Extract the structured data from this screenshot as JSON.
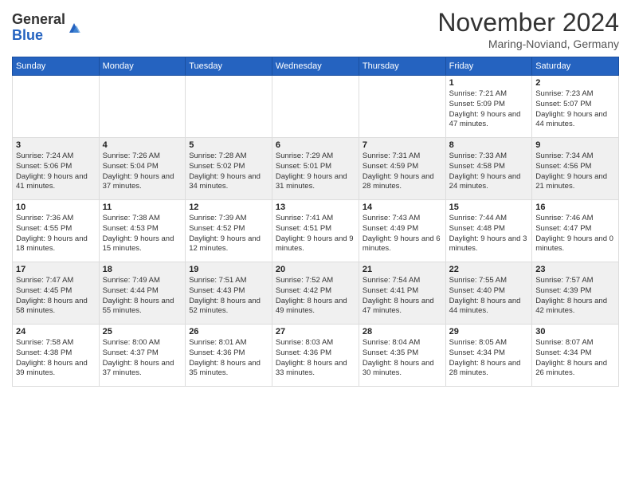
{
  "logo": {
    "line1": "General",
    "line2": "Blue"
  },
  "title": "November 2024",
  "location": "Maring-Noviand, Germany",
  "weekdays": [
    "Sunday",
    "Monday",
    "Tuesday",
    "Wednesday",
    "Thursday",
    "Friday",
    "Saturday"
  ],
  "weeks": [
    [
      {
        "day": "",
        "info": ""
      },
      {
        "day": "",
        "info": ""
      },
      {
        "day": "",
        "info": ""
      },
      {
        "day": "",
        "info": ""
      },
      {
        "day": "",
        "info": ""
      },
      {
        "day": "1",
        "info": "Sunrise: 7:21 AM\nSunset: 5:09 PM\nDaylight: 9 hours and 47 minutes."
      },
      {
        "day": "2",
        "info": "Sunrise: 7:23 AM\nSunset: 5:07 PM\nDaylight: 9 hours and 44 minutes."
      }
    ],
    [
      {
        "day": "3",
        "info": "Sunrise: 7:24 AM\nSunset: 5:06 PM\nDaylight: 9 hours and 41 minutes."
      },
      {
        "day": "4",
        "info": "Sunrise: 7:26 AM\nSunset: 5:04 PM\nDaylight: 9 hours and 37 minutes."
      },
      {
        "day": "5",
        "info": "Sunrise: 7:28 AM\nSunset: 5:02 PM\nDaylight: 9 hours and 34 minutes."
      },
      {
        "day": "6",
        "info": "Sunrise: 7:29 AM\nSunset: 5:01 PM\nDaylight: 9 hours and 31 minutes."
      },
      {
        "day": "7",
        "info": "Sunrise: 7:31 AM\nSunset: 4:59 PM\nDaylight: 9 hours and 28 minutes."
      },
      {
        "day": "8",
        "info": "Sunrise: 7:33 AM\nSunset: 4:58 PM\nDaylight: 9 hours and 24 minutes."
      },
      {
        "day": "9",
        "info": "Sunrise: 7:34 AM\nSunset: 4:56 PM\nDaylight: 9 hours and 21 minutes."
      }
    ],
    [
      {
        "day": "10",
        "info": "Sunrise: 7:36 AM\nSunset: 4:55 PM\nDaylight: 9 hours and 18 minutes."
      },
      {
        "day": "11",
        "info": "Sunrise: 7:38 AM\nSunset: 4:53 PM\nDaylight: 9 hours and 15 minutes."
      },
      {
        "day": "12",
        "info": "Sunrise: 7:39 AM\nSunset: 4:52 PM\nDaylight: 9 hours and 12 minutes."
      },
      {
        "day": "13",
        "info": "Sunrise: 7:41 AM\nSunset: 4:51 PM\nDaylight: 9 hours and 9 minutes."
      },
      {
        "day": "14",
        "info": "Sunrise: 7:43 AM\nSunset: 4:49 PM\nDaylight: 9 hours and 6 minutes."
      },
      {
        "day": "15",
        "info": "Sunrise: 7:44 AM\nSunset: 4:48 PM\nDaylight: 9 hours and 3 minutes."
      },
      {
        "day": "16",
        "info": "Sunrise: 7:46 AM\nSunset: 4:47 PM\nDaylight: 9 hours and 0 minutes."
      }
    ],
    [
      {
        "day": "17",
        "info": "Sunrise: 7:47 AM\nSunset: 4:45 PM\nDaylight: 8 hours and 58 minutes."
      },
      {
        "day": "18",
        "info": "Sunrise: 7:49 AM\nSunset: 4:44 PM\nDaylight: 8 hours and 55 minutes."
      },
      {
        "day": "19",
        "info": "Sunrise: 7:51 AM\nSunset: 4:43 PM\nDaylight: 8 hours and 52 minutes."
      },
      {
        "day": "20",
        "info": "Sunrise: 7:52 AM\nSunset: 4:42 PM\nDaylight: 8 hours and 49 minutes."
      },
      {
        "day": "21",
        "info": "Sunrise: 7:54 AM\nSunset: 4:41 PM\nDaylight: 8 hours and 47 minutes."
      },
      {
        "day": "22",
        "info": "Sunrise: 7:55 AM\nSunset: 4:40 PM\nDaylight: 8 hours and 44 minutes."
      },
      {
        "day": "23",
        "info": "Sunrise: 7:57 AM\nSunset: 4:39 PM\nDaylight: 8 hours and 42 minutes."
      }
    ],
    [
      {
        "day": "24",
        "info": "Sunrise: 7:58 AM\nSunset: 4:38 PM\nDaylight: 8 hours and 39 minutes."
      },
      {
        "day": "25",
        "info": "Sunrise: 8:00 AM\nSunset: 4:37 PM\nDaylight: 8 hours and 37 minutes."
      },
      {
        "day": "26",
        "info": "Sunrise: 8:01 AM\nSunset: 4:36 PM\nDaylight: 8 hours and 35 minutes."
      },
      {
        "day": "27",
        "info": "Sunrise: 8:03 AM\nSunset: 4:36 PM\nDaylight: 8 hours and 33 minutes."
      },
      {
        "day": "28",
        "info": "Sunrise: 8:04 AM\nSunset: 4:35 PM\nDaylight: 8 hours and 30 minutes."
      },
      {
        "day": "29",
        "info": "Sunrise: 8:05 AM\nSunset: 4:34 PM\nDaylight: 8 hours and 28 minutes."
      },
      {
        "day": "30",
        "info": "Sunrise: 8:07 AM\nSunset: 4:34 PM\nDaylight: 8 hours and 26 minutes."
      }
    ]
  ]
}
